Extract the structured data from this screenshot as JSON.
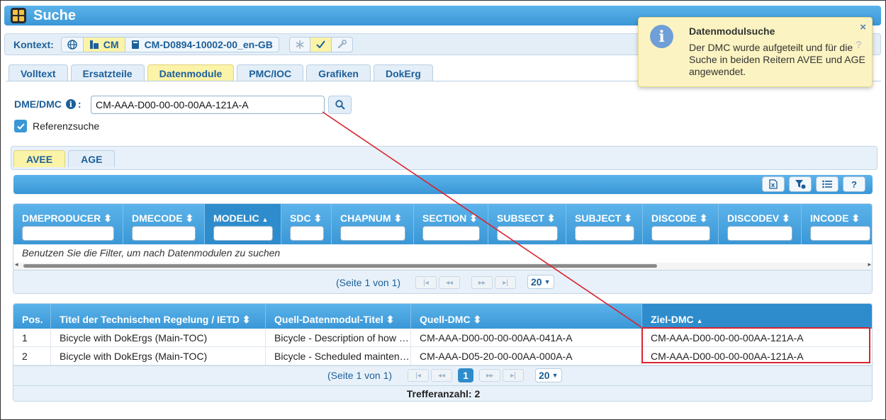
{
  "window": {
    "title": "Suche"
  },
  "context": {
    "label": "Kontext:",
    "project": "CM",
    "document": "CM-D0894-10002-00_en-GB"
  },
  "tabs": [
    {
      "label": "Volltext"
    },
    {
      "label": "Ersatzteile"
    },
    {
      "label": "Datenmodule",
      "active": true
    },
    {
      "label": "PMC/IOC"
    },
    {
      "label": "Grafiken"
    },
    {
      "label": "DokErg"
    }
  ],
  "search": {
    "label": "DME/DMC",
    "label_suffix": ":",
    "value": "CM-AAA-D00-00-00-00AA-121A-A",
    "reference_label": "Referenzsuche",
    "reference_checked": true
  },
  "subtabs": [
    {
      "label": "AVEE",
      "active": true
    },
    {
      "label": "AGE"
    }
  ],
  "toolbar": {
    "help_label": "?"
  },
  "filter_grid": {
    "columns": [
      "DMEPRODUCER",
      "DMECODE",
      "MODELIC",
      "SDC",
      "CHAPNUM",
      "SECTION",
      "SUBSECT",
      "SUBJECT",
      "DISCODE",
      "DISCODEV",
      "INCODE"
    ],
    "sort_icons": [
      "⬍",
      "⬍",
      "▲",
      "⬍",
      "⬍",
      "⬍",
      "⬍",
      "⬍",
      "⬍",
      "⬍",
      "⬍"
    ],
    "empty_message": "Benutzen Sie die Filter, um nach Datenmodulen zu suchen",
    "pager_text": "(Seite 1 von 1)",
    "page_size": "20"
  },
  "result_grid": {
    "columns": [
      "Pos.",
      "Titel der Technischen Regelung / IETD",
      "Quell-Datenmodul-Titel",
      "Quell-DMC",
      "Ziel-DMC"
    ],
    "sort_icons": [
      "",
      "⬍",
      "⬍",
      "⬍",
      "▲"
    ],
    "rows": [
      [
        "1",
        "Bicycle with DokErgs (Main-TOC)",
        "Bicycle - Description of how it is made",
        "CM-AAA-D00-00-00-00AA-041A-A",
        "CM-AAA-D00-00-00-00AA-121A-A"
      ],
      [
        "2",
        "Bicycle with DokErgs (Main-TOC)",
        "Bicycle - Scheduled maintenance",
        "CM-AAA-D05-20-00-00AA-000A-A",
        "CM-AAA-D00-00-00-00AA-121A-A"
      ]
    ],
    "pager_text": "(Seite 1 von 1)",
    "current_page": "1",
    "page_size": "20",
    "hit_count": "Trefferanzahl: 2"
  },
  "notification": {
    "title": "Datenmodulsuche",
    "message": "Der DMC wurde aufgeteilt und für die Suche in beiden Reitern AVEE und AGE angewendet.",
    "close": "×",
    "icon": "i"
  },
  "colors": {
    "accent": "#3a97d6",
    "highlight": "#fbf3a8",
    "annotation": "#d9232e"
  }
}
